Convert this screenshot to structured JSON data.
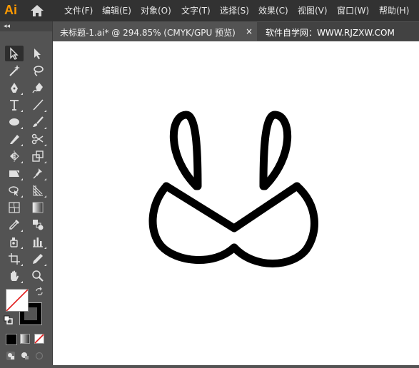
{
  "app": {
    "logo_text": "Ai",
    "accent_color": "#ff9a00"
  },
  "menu": {
    "items": [
      {
        "label": "文件(F)"
      },
      {
        "label": "编辑(E)"
      },
      {
        "label": "对象(O)"
      },
      {
        "label": "文字(T)"
      },
      {
        "label": "选择(S)"
      },
      {
        "label": "效果(C)"
      },
      {
        "label": "视图(V)"
      },
      {
        "label": "窗口(W)"
      },
      {
        "label": "帮助(H)"
      }
    ]
  },
  "document": {
    "tab_title": "未标题-1.ai* @ 294.85% (CMYK/GPU 预览)",
    "close_glyph": "×",
    "zoom_percent": 294.85
  },
  "watermark": {
    "text": "软件自学网：WWW.RJZXW.COM"
  },
  "toolbar": {
    "collapse_glyph": "◂◂",
    "tools": [
      "selection-tool-icon",
      "direct-selection-tool-icon",
      "magic-wand-tool-icon",
      "lasso-tool-icon",
      "pen-tool-icon",
      "curvature-tool-icon",
      "type-tool-icon",
      "line-segment-tool-icon",
      "ellipse-tool-icon",
      "paintbrush-tool-icon",
      "pencil-tool-icon",
      "scissors-tool-icon",
      "reflect-tool-icon",
      "scale-tool-icon",
      "eraser-tool-icon",
      "puppet-warp-tool-icon",
      "free-transform-tool-icon",
      "perspective-grid-tool-icon",
      "mesh-tool-icon",
      "gradient-tool-icon",
      "eyedropper-tool-icon",
      "blend-tool-icon",
      "symbol-sprayer-tool-icon",
      "column-graph-tool-icon",
      "artboard-tool-icon",
      "slice-tool-icon",
      "hand-tool-icon",
      "zoom-tool-icon"
    ],
    "fill_color": "#ffffff",
    "stroke_color": "#000000"
  }
}
